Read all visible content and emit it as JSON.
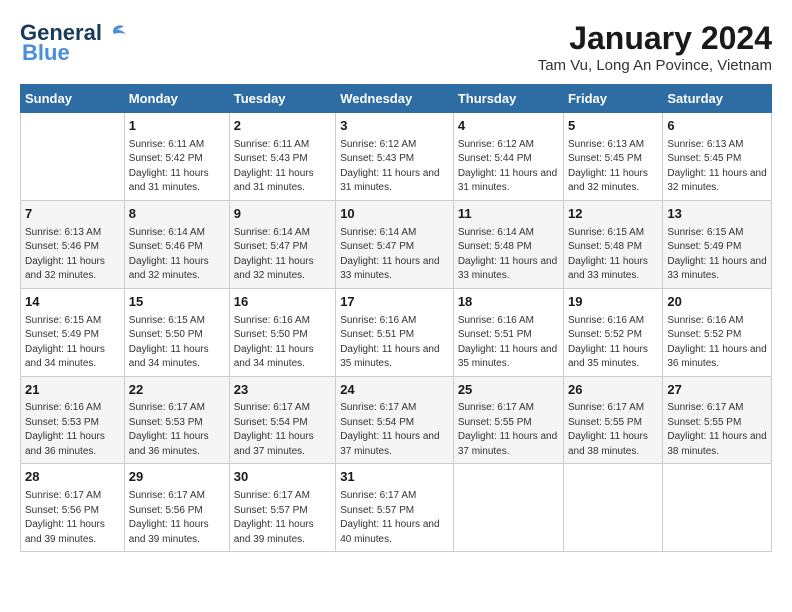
{
  "logo": {
    "line1": "General",
    "line2": "Blue"
  },
  "title": "January 2024",
  "subtitle": "Tam Vu, Long An Povince, Vietnam",
  "days_header": [
    "Sunday",
    "Monday",
    "Tuesday",
    "Wednesday",
    "Thursday",
    "Friday",
    "Saturday"
  ],
  "weeks": [
    [
      {
        "num": "",
        "sunrise": "",
        "sunset": "",
        "daylight": ""
      },
      {
        "num": "1",
        "sunrise": "Sunrise: 6:11 AM",
        "sunset": "Sunset: 5:42 PM",
        "daylight": "Daylight: 11 hours and 31 minutes."
      },
      {
        "num": "2",
        "sunrise": "Sunrise: 6:11 AM",
        "sunset": "Sunset: 5:43 PM",
        "daylight": "Daylight: 11 hours and 31 minutes."
      },
      {
        "num": "3",
        "sunrise": "Sunrise: 6:12 AM",
        "sunset": "Sunset: 5:43 PM",
        "daylight": "Daylight: 11 hours and 31 minutes."
      },
      {
        "num": "4",
        "sunrise": "Sunrise: 6:12 AM",
        "sunset": "Sunset: 5:44 PM",
        "daylight": "Daylight: 11 hours and 31 minutes."
      },
      {
        "num": "5",
        "sunrise": "Sunrise: 6:13 AM",
        "sunset": "Sunset: 5:45 PM",
        "daylight": "Daylight: 11 hours and 32 minutes."
      },
      {
        "num": "6",
        "sunrise": "Sunrise: 6:13 AM",
        "sunset": "Sunset: 5:45 PM",
        "daylight": "Daylight: 11 hours and 32 minutes."
      }
    ],
    [
      {
        "num": "7",
        "sunrise": "Sunrise: 6:13 AM",
        "sunset": "Sunset: 5:46 PM",
        "daylight": "Daylight: 11 hours and 32 minutes."
      },
      {
        "num": "8",
        "sunrise": "Sunrise: 6:14 AM",
        "sunset": "Sunset: 5:46 PM",
        "daylight": "Daylight: 11 hours and 32 minutes."
      },
      {
        "num": "9",
        "sunrise": "Sunrise: 6:14 AM",
        "sunset": "Sunset: 5:47 PM",
        "daylight": "Daylight: 11 hours and 32 minutes."
      },
      {
        "num": "10",
        "sunrise": "Sunrise: 6:14 AM",
        "sunset": "Sunset: 5:47 PM",
        "daylight": "Daylight: 11 hours and 33 minutes."
      },
      {
        "num": "11",
        "sunrise": "Sunrise: 6:14 AM",
        "sunset": "Sunset: 5:48 PM",
        "daylight": "Daylight: 11 hours and 33 minutes."
      },
      {
        "num": "12",
        "sunrise": "Sunrise: 6:15 AM",
        "sunset": "Sunset: 5:48 PM",
        "daylight": "Daylight: 11 hours and 33 minutes."
      },
      {
        "num": "13",
        "sunrise": "Sunrise: 6:15 AM",
        "sunset": "Sunset: 5:49 PM",
        "daylight": "Daylight: 11 hours and 33 minutes."
      }
    ],
    [
      {
        "num": "14",
        "sunrise": "Sunrise: 6:15 AM",
        "sunset": "Sunset: 5:49 PM",
        "daylight": "Daylight: 11 hours and 34 minutes."
      },
      {
        "num": "15",
        "sunrise": "Sunrise: 6:15 AM",
        "sunset": "Sunset: 5:50 PM",
        "daylight": "Daylight: 11 hours and 34 minutes."
      },
      {
        "num": "16",
        "sunrise": "Sunrise: 6:16 AM",
        "sunset": "Sunset: 5:50 PM",
        "daylight": "Daylight: 11 hours and 34 minutes."
      },
      {
        "num": "17",
        "sunrise": "Sunrise: 6:16 AM",
        "sunset": "Sunset: 5:51 PM",
        "daylight": "Daylight: 11 hours and 35 minutes."
      },
      {
        "num": "18",
        "sunrise": "Sunrise: 6:16 AM",
        "sunset": "Sunset: 5:51 PM",
        "daylight": "Daylight: 11 hours and 35 minutes."
      },
      {
        "num": "19",
        "sunrise": "Sunrise: 6:16 AM",
        "sunset": "Sunset: 5:52 PM",
        "daylight": "Daylight: 11 hours and 35 minutes."
      },
      {
        "num": "20",
        "sunrise": "Sunrise: 6:16 AM",
        "sunset": "Sunset: 5:52 PM",
        "daylight": "Daylight: 11 hours and 36 minutes."
      }
    ],
    [
      {
        "num": "21",
        "sunrise": "Sunrise: 6:16 AM",
        "sunset": "Sunset: 5:53 PM",
        "daylight": "Daylight: 11 hours and 36 minutes."
      },
      {
        "num": "22",
        "sunrise": "Sunrise: 6:17 AM",
        "sunset": "Sunset: 5:53 PM",
        "daylight": "Daylight: 11 hours and 36 minutes."
      },
      {
        "num": "23",
        "sunrise": "Sunrise: 6:17 AM",
        "sunset": "Sunset: 5:54 PM",
        "daylight": "Daylight: 11 hours and 37 minutes."
      },
      {
        "num": "24",
        "sunrise": "Sunrise: 6:17 AM",
        "sunset": "Sunset: 5:54 PM",
        "daylight": "Daylight: 11 hours and 37 minutes."
      },
      {
        "num": "25",
        "sunrise": "Sunrise: 6:17 AM",
        "sunset": "Sunset: 5:55 PM",
        "daylight": "Daylight: 11 hours and 37 minutes."
      },
      {
        "num": "26",
        "sunrise": "Sunrise: 6:17 AM",
        "sunset": "Sunset: 5:55 PM",
        "daylight": "Daylight: 11 hours and 38 minutes."
      },
      {
        "num": "27",
        "sunrise": "Sunrise: 6:17 AM",
        "sunset": "Sunset: 5:55 PM",
        "daylight": "Daylight: 11 hours and 38 minutes."
      }
    ],
    [
      {
        "num": "28",
        "sunrise": "Sunrise: 6:17 AM",
        "sunset": "Sunset: 5:56 PM",
        "daylight": "Daylight: 11 hours and 39 minutes."
      },
      {
        "num": "29",
        "sunrise": "Sunrise: 6:17 AM",
        "sunset": "Sunset: 5:56 PM",
        "daylight": "Daylight: 11 hours and 39 minutes."
      },
      {
        "num": "30",
        "sunrise": "Sunrise: 6:17 AM",
        "sunset": "Sunset: 5:57 PM",
        "daylight": "Daylight: 11 hours and 39 minutes."
      },
      {
        "num": "31",
        "sunrise": "Sunrise: 6:17 AM",
        "sunset": "Sunset: 5:57 PM",
        "daylight": "Daylight: 11 hours and 40 minutes."
      },
      {
        "num": "",
        "sunrise": "",
        "sunset": "",
        "daylight": ""
      },
      {
        "num": "",
        "sunrise": "",
        "sunset": "",
        "daylight": ""
      },
      {
        "num": "",
        "sunrise": "",
        "sunset": "",
        "daylight": ""
      }
    ]
  ]
}
